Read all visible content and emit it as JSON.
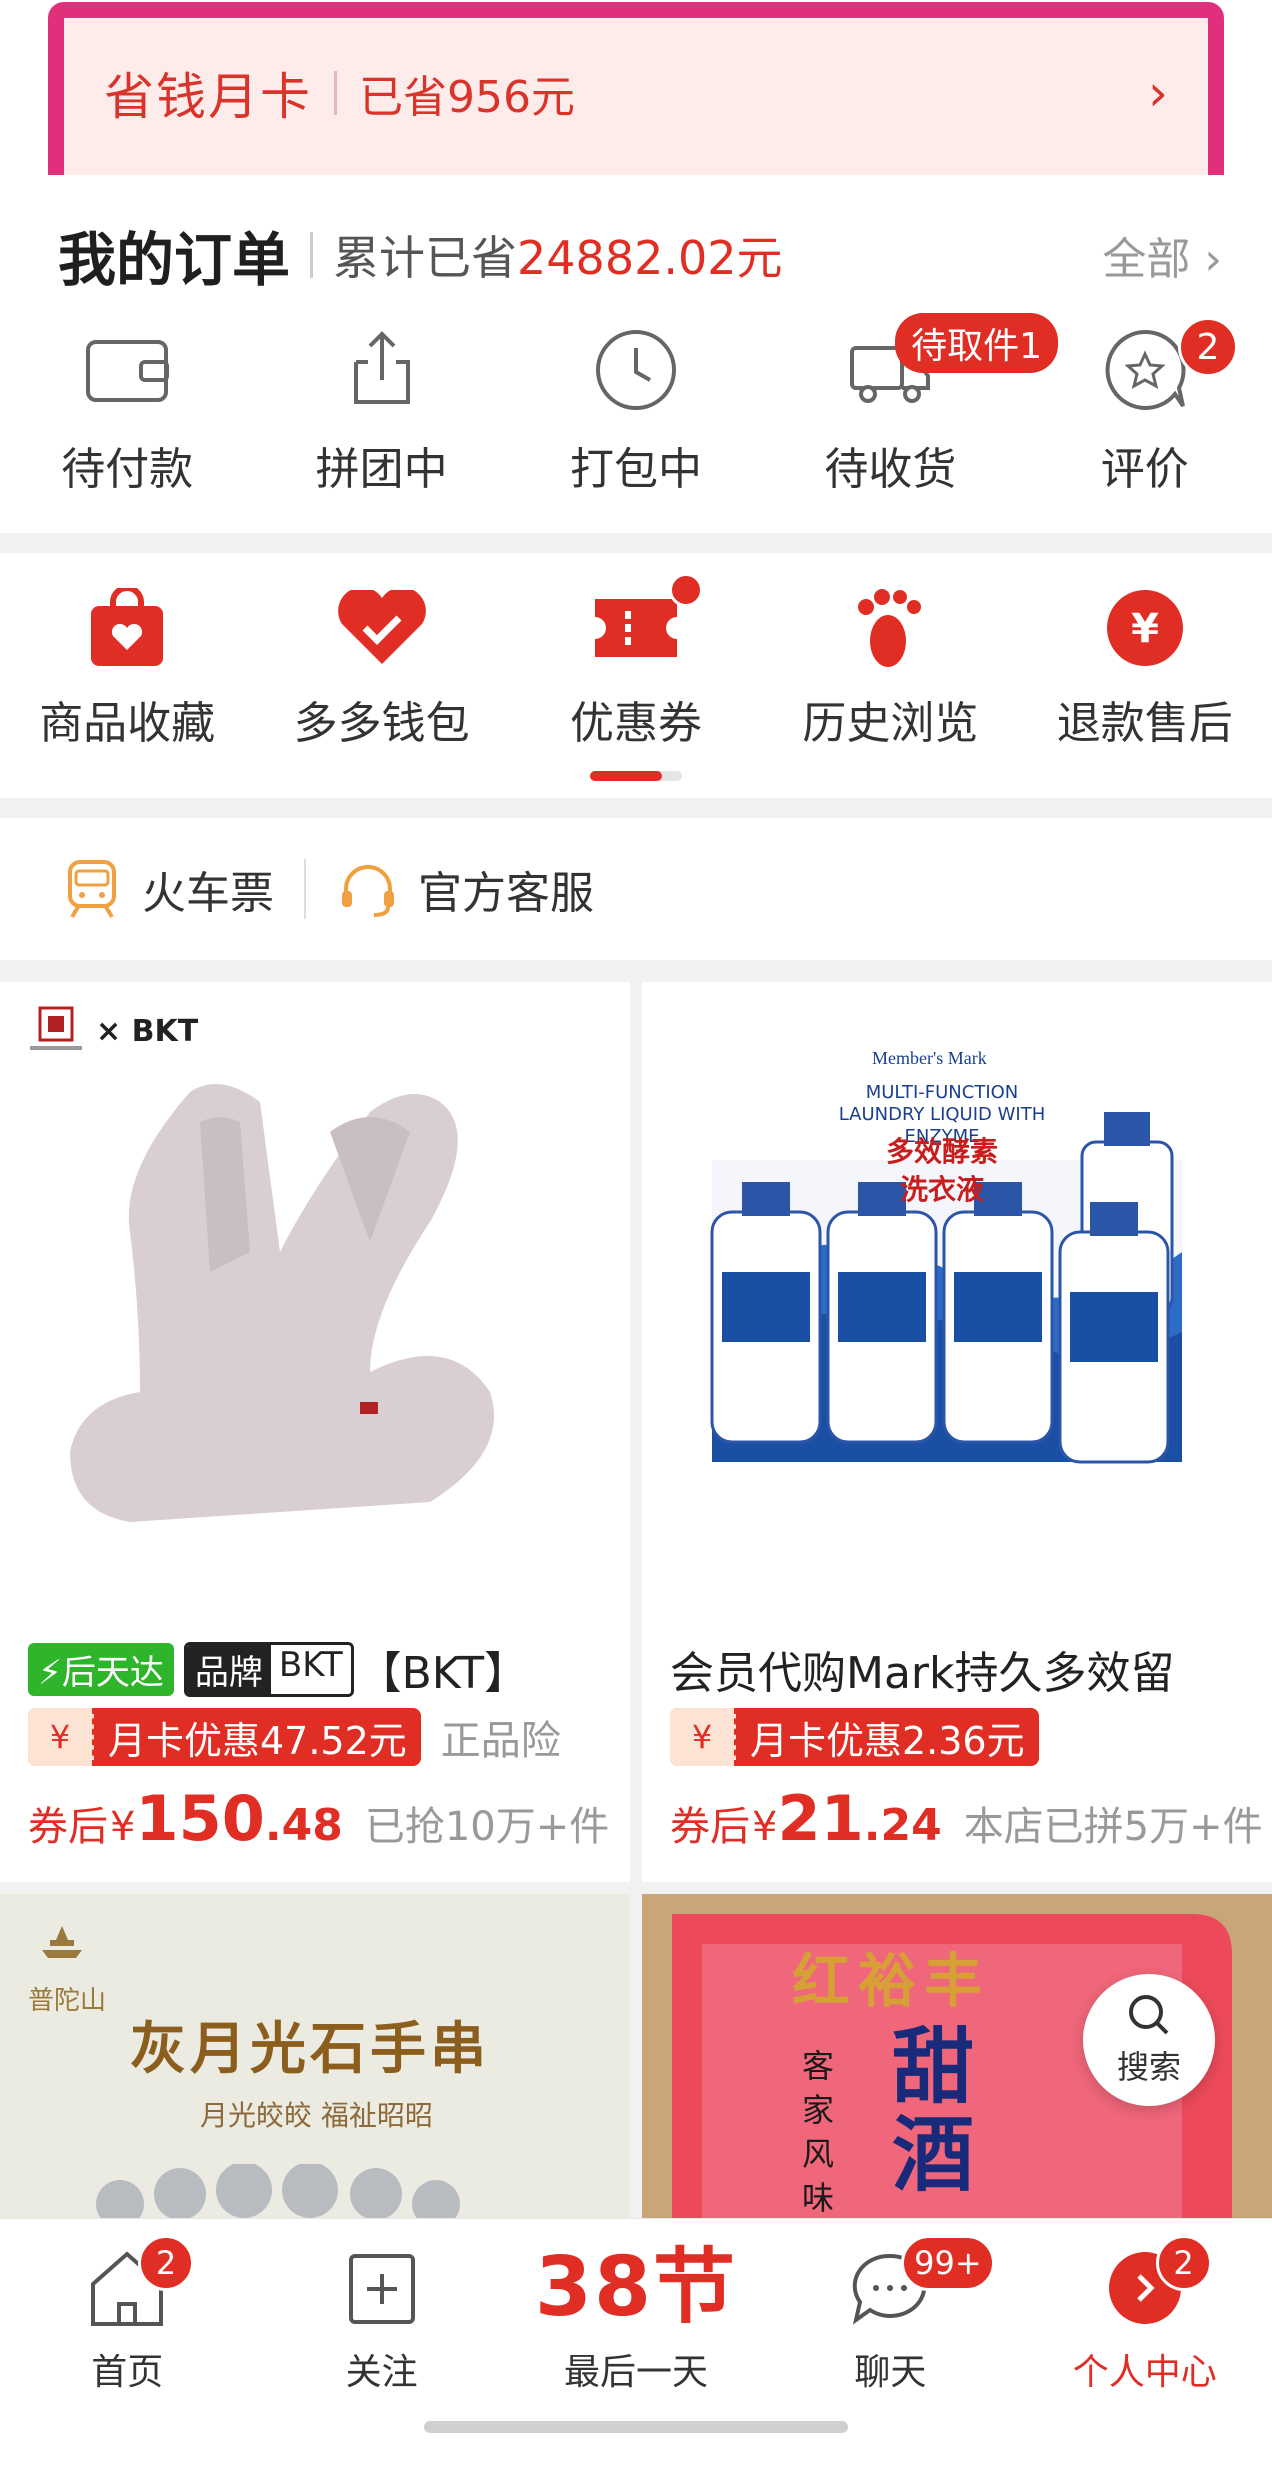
{
  "month_card": {
    "title": "省钱月卡",
    "saved": "已省956元",
    "arrow": "›"
  },
  "orders": {
    "title": "我的订单",
    "summary_prefix": "累计已省",
    "summary_amount": "24882.02元",
    "all": "全部 ›",
    "items": [
      {
        "label": "待付款",
        "icon": "wallet-icon"
      },
      {
        "label": "拼团中",
        "icon": "share-box-icon"
      },
      {
        "label": "打包中",
        "icon": "clock-icon"
      },
      {
        "label": "待收货",
        "icon": "truck-icon",
        "badge": "待取件1"
      },
      {
        "label": "评价",
        "icon": "star-chat-icon",
        "badge": "2"
      }
    ]
  },
  "tools": {
    "items": [
      {
        "label": "商品收藏",
        "icon": "favorite-bag-icon"
      },
      {
        "label": "多多钱包",
        "icon": "heart-wallet-icon"
      },
      {
        "label": "优惠券",
        "icon": "ticket-icon",
        "dot": true
      },
      {
        "label": "历史浏览",
        "icon": "footprint-icon"
      },
      {
        "label": "退款售后",
        "icon": "yen-circle-icon"
      }
    ]
  },
  "services": [
    {
      "label": "火车票",
      "icon": "train-icon"
    },
    {
      "label": "官方客服",
      "icon": "headset-icon"
    }
  ],
  "products": [
    {
      "logo": "× BKT",
      "tag_fast": "⚡后天达",
      "tag_brand_a": "品牌",
      "tag_brand_b": "BKT",
      "title": "【BKT】",
      "coupon_symbol": "¥",
      "coupon": "月卡优惠47.52元",
      "extra": "正品险",
      "price_prefix": "券后",
      "currency": "¥",
      "price_int": "150",
      "price_dec": ".48",
      "sold": "已抢10万+件"
    },
    {
      "box_brand": "Member's Mark",
      "box_en": "MULTI-FUNCTION LAUNDRY LIQUID WITH ENZYME",
      "box_cn1": "多效酵素",
      "box_cn2": "洗衣液",
      "title": "会员代购Mark持久多效留",
      "coupon_symbol": "¥",
      "coupon": "月卡优惠2.36元",
      "price_prefix": "券后",
      "currency": "¥",
      "price_int": "21",
      "price_dec": ".24",
      "sold": "本店已拼5万+件"
    },
    {
      "brand": "普陀山",
      "title": "灰月光石手串",
      "subtitle": "月光皎皎 福祉昭昭"
    },
    {
      "text1": "红裕丰",
      "text2": "甜酒",
      "text3": "客家风味"
    }
  ],
  "float_search": {
    "label": "搜索",
    "icon": "search-icon"
  },
  "bottom_nav": [
    {
      "label": "首页",
      "icon": "home-icon",
      "badge": "2"
    },
    {
      "label": "关注",
      "icon": "plus-box-icon"
    },
    {
      "label": "最后一天",
      "festival": "38节"
    },
    {
      "label": "聊天",
      "icon": "chat-icon",
      "badge": "99+"
    },
    {
      "label": "个人中心",
      "icon": "person-icon",
      "badge": "2",
      "active": true
    }
  ],
  "colors": {
    "accent": "#e02e24",
    "highlight_border": "#e0307c",
    "green_tag": "#2fb52b"
  }
}
